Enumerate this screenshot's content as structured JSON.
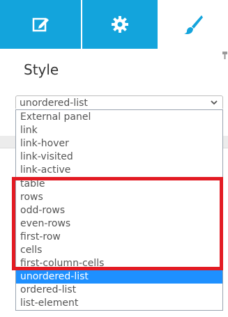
{
  "tabs": [
    {
      "icon": "edit-icon",
      "active": false
    },
    {
      "icon": "gear-icon",
      "active": false
    },
    {
      "icon": "paintbrush-icon",
      "active": true
    }
  ],
  "panel": {
    "title": "Style"
  },
  "select": {
    "selected": "unordered-list"
  },
  "options": [
    "External panel",
    "link",
    "link-hover",
    "link-visited",
    "link-active",
    "table",
    "rows",
    "odd-rows",
    "even-rows",
    "first-row",
    "cells",
    "first-column-cells",
    "unordered-list",
    "ordered-list",
    "list-element"
  ],
  "colors": {
    "tab_blue": "#13a4dc",
    "highlight_red": "#e31b23",
    "selected_blue": "#1e90ff"
  }
}
